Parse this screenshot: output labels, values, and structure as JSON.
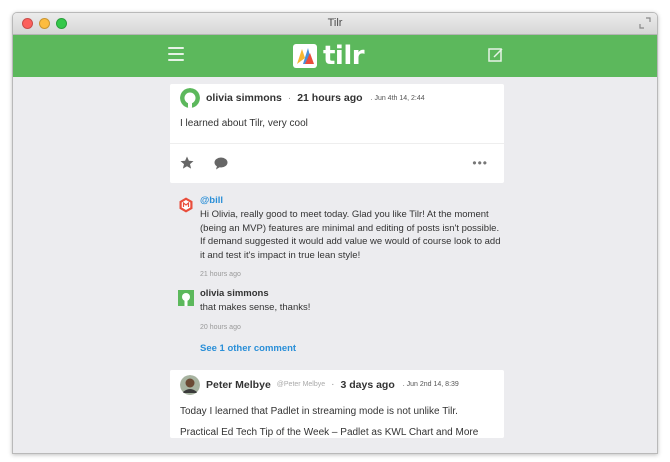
{
  "window": {
    "title": "Tilr"
  },
  "app": {
    "logo_text": "tilr"
  },
  "post": {
    "author": "olivia simmons",
    "separator": "·",
    "ago": "21 hours ago",
    "stamp": ". Jun 4th 14, 2:44",
    "body": "I learned about Tilr, very cool",
    "more": "•••"
  },
  "comments": [
    {
      "author": "@bill",
      "text": "Hi Olivia, really good to meet today. Glad you like Tilr! At the moment (being an MVP) features are minimal and editing of posts isn't possible. If demand suggested it would add value we would of course look to add it and test it's impact in true lean style!",
      "time": "21 hours ago"
    },
    {
      "author": "olivia simmons",
      "text": "that makes sense, thanks!",
      "time": "20 hours ago"
    }
  ],
  "see_more": "See 1 other comment",
  "post2": {
    "author": "Peter Melbye",
    "handle": "@Peter Melbye",
    "separator": "·",
    "ago": "3 days ago",
    "stamp": ". Jun 2nd 14, 8:39",
    "body1": "Today I learned that Padlet in streaming mode is not unlike Tilr.",
    "body2": "Practical Ed Tech Tip of the Week – Padlet as KWL Chart and More"
  },
  "colors": {
    "brand": "#5cb85c",
    "link": "#2a8fd8"
  }
}
